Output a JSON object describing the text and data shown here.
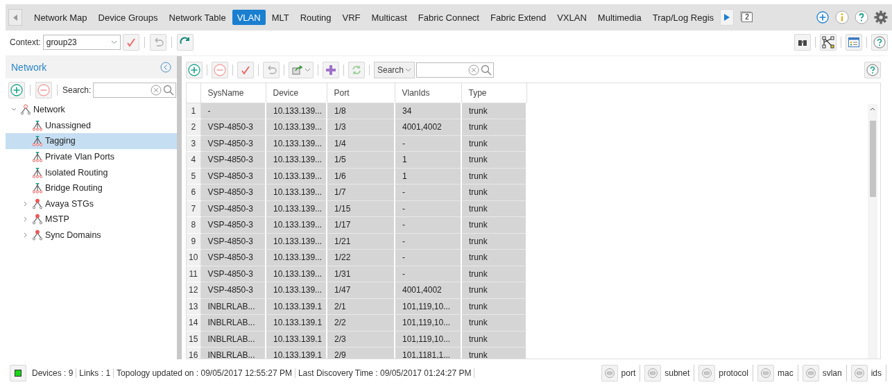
{
  "tabs": [
    {
      "label": "Network Map",
      "selected": false
    },
    {
      "label": "Device Groups",
      "selected": false
    },
    {
      "label": "Network Table",
      "selected": false
    },
    {
      "label": "VLAN",
      "selected": true
    },
    {
      "label": "MLT",
      "selected": false
    },
    {
      "label": "Routing",
      "selected": false
    },
    {
      "label": "VRF",
      "selected": false
    },
    {
      "label": "Multicast",
      "selected": false
    },
    {
      "label": "Fabric Connect",
      "selected": false
    },
    {
      "label": "Fabric Extend",
      "selected": false
    },
    {
      "label": "VXLAN",
      "selected": false
    },
    {
      "label": "Multimedia",
      "selected": false
    },
    {
      "label": "Trap/Log Regis",
      "selected": false
    }
  ],
  "window_count": "2",
  "context": {
    "label": "Context:",
    "value": "group23"
  },
  "sidebar": {
    "title": "Network",
    "search_label": "Search:",
    "tree": [
      {
        "label": "Network",
        "kind": "root",
        "expanded": true,
        "selected": false,
        "children": [
          {
            "label": "Unassigned",
            "kind": "group",
            "selected": false
          },
          {
            "label": "Tagging",
            "kind": "group",
            "selected": true
          },
          {
            "label": "Private Vlan Ports",
            "kind": "group",
            "selected": false
          },
          {
            "label": "Isolated Routing",
            "kind": "group",
            "selected": false
          },
          {
            "label": "Bridge Routing",
            "kind": "group",
            "selected": false
          },
          {
            "label": "Avaya STGs",
            "kind": "folder",
            "expanded": false,
            "selected": false
          },
          {
            "label": "MSTP",
            "kind": "folder",
            "expanded": false,
            "selected": false
          },
          {
            "label": "Sync Domains",
            "kind": "folder",
            "expanded": false,
            "selected": false
          }
        ]
      }
    ]
  },
  "toolbar": {
    "search_mode": "Search"
  },
  "table": {
    "columns": [
      "",
      "SysName",
      "Device",
      "Port",
      "VlanIds",
      "Type"
    ],
    "rows": [
      [
        "1",
        "-",
        "10.133.139...",
        "1/8",
        "34",
        "trunk"
      ],
      [
        "2",
        "VSP-4850-3",
        "10.133.139...",
        "1/3",
        "4001,4002",
        "trunk"
      ],
      [
        "3",
        "VSP-4850-3",
        "10.133.139...",
        "1/4",
        "-",
        "trunk"
      ],
      [
        "4",
        "VSP-4850-3",
        "10.133.139...",
        "1/5",
        "1",
        "trunk"
      ],
      [
        "5",
        "VSP-4850-3",
        "10.133.139...",
        "1/6",
        "1",
        "trunk"
      ],
      [
        "6",
        "VSP-4850-3",
        "10.133.139...",
        "1/7",
        "-",
        "trunk"
      ],
      [
        "7",
        "VSP-4850-3",
        "10.133.139...",
        "1/15",
        "-",
        "trunk"
      ],
      [
        "8",
        "VSP-4850-3",
        "10.133.139...",
        "1/17",
        "-",
        "trunk"
      ],
      [
        "9",
        "VSP-4850-3",
        "10.133.139...",
        "1/21",
        "-",
        "trunk"
      ],
      [
        "10",
        "VSP-4850-3",
        "10.133.139...",
        "1/22",
        "-",
        "trunk"
      ],
      [
        "11",
        "VSP-4850-3",
        "10.133.139...",
        "1/31",
        "-",
        "trunk"
      ],
      [
        "12",
        "VSP-4850-3",
        "10.133.139...",
        "1/47",
        "4001,4002",
        "trunk"
      ],
      [
        "13",
        "INBLRLAB...",
        "10.133.139.1",
        "2/1",
        "101,119,10...",
        "trunk"
      ],
      [
        "14",
        "INBLRLAB...",
        "10.133.139.1",
        "2/2",
        "101,119,10...",
        "trunk"
      ],
      [
        "15",
        "INBLRLAB...",
        "10.133.139.1",
        "2/3",
        "101,119,10...",
        "trunk"
      ],
      [
        "16",
        "INBLRLAB...",
        "10.133.139.1",
        "2/9",
        "101,1181,1...",
        "trunk"
      ]
    ]
  },
  "status_bar": {
    "items": [
      "Devices : 9",
      "Links : 1",
      "Topology updated on : 09/05/2017 12:55:27 PM",
      "Last Discovery Time :  09/05/2017 01:24:27 PM"
    ],
    "filters": [
      "port",
      "subnet",
      "protocol",
      "mac",
      "svlan",
      "ids"
    ]
  }
}
